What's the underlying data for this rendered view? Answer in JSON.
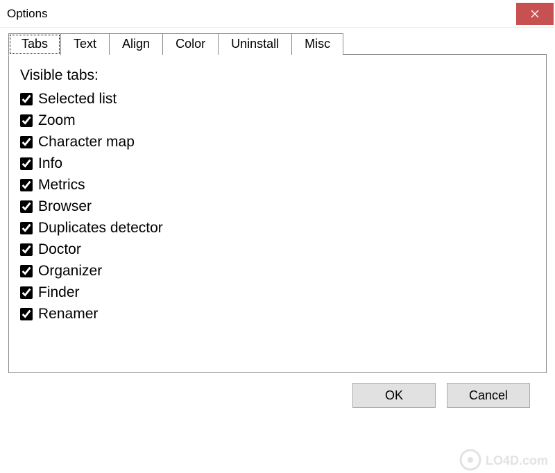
{
  "window": {
    "title": "Options"
  },
  "tabs": [
    {
      "label": "Tabs",
      "active": true
    },
    {
      "label": "Text",
      "active": false
    },
    {
      "label": "Align",
      "active": false
    },
    {
      "label": "Color",
      "active": false
    },
    {
      "label": "Uninstall",
      "active": false
    },
    {
      "label": "Misc",
      "active": false
    }
  ],
  "panel": {
    "section_label": "Visible tabs:"
  },
  "visible_tabs": [
    {
      "label": "Selected list",
      "checked": true
    },
    {
      "label": "Zoom",
      "checked": true
    },
    {
      "label": "Character map",
      "checked": true
    },
    {
      "label": "Info",
      "checked": true
    },
    {
      "label": "Metrics",
      "checked": true
    },
    {
      "label": "Browser",
      "checked": true
    },
    {
      "label": "Duplicates detector",
      "checked": true
    },
    {
      "label": "Doctor",
      "checked": true
    },
    {
      "label": "Organizer",
      "checked": true
    },
    {
      "label": "Finder",
      "checked": true
    },
    {
      "label": "Renamer",
      "checked": true
    }
  ],
  "buttons": {
    "ok": "OK",
    "cancel": "Cancel"
  },
  "watermark": "LO4D.com"
}
